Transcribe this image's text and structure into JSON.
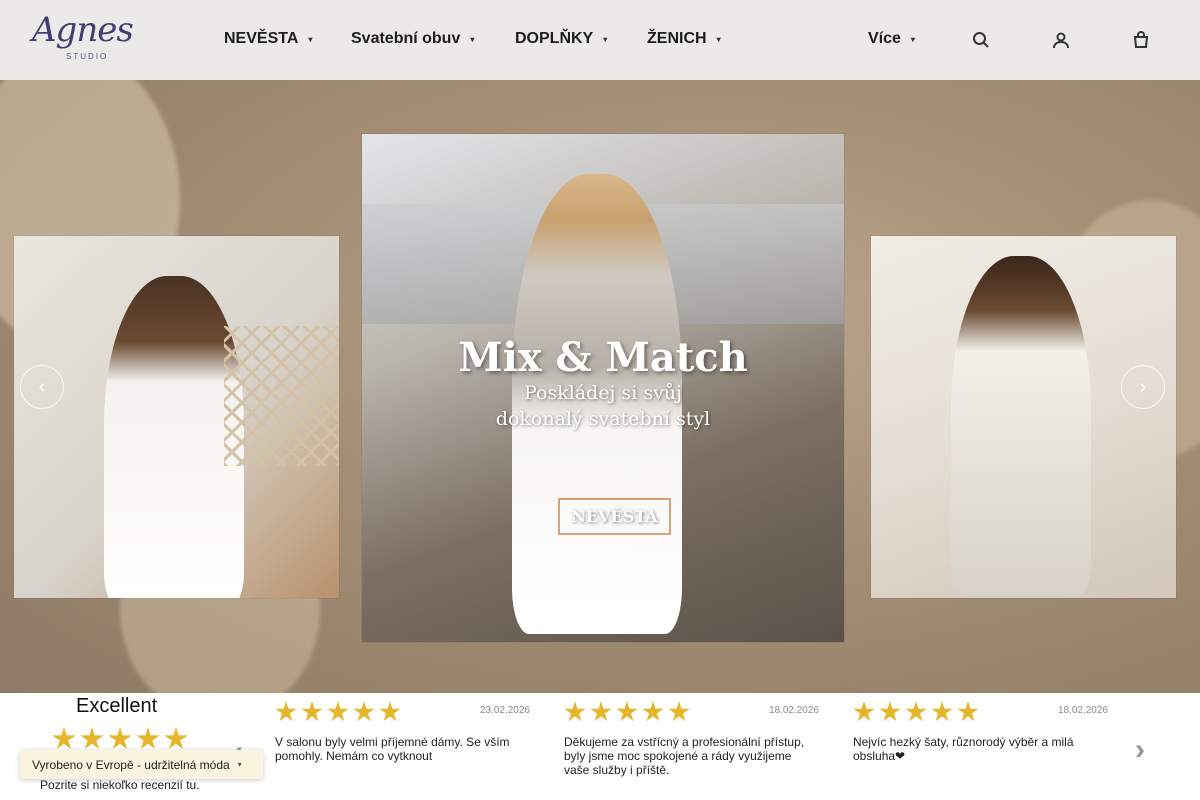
{
  "logo": {
    "script": "Agnes",
    "sub": "STUDIO"
  },
  "nav": {
    "items": [
      {
        "label": "NEVĚSTA"
      },
      {
        "label": "Svatební obuv"
      },
      {
        "label": "DOPLŇKY"
      },
      {
        "label": "ŽENICH"
      },
      {
        "label": "Více"
      }
    ],
    "icons": [
      "search-icon",
      "user-icon",
      "cart-icon"
    ]
  },
  "hero": {
    "title": "Mix & Match",
    "subtitle_line1": "Poskládej si svůj",
    "subtitle_line2": "dokonalý svatební styl",
    "button": "NEVĚSTA"
  },
  "reviews": {
    "summary": "Excellent",
    "rating_stars": 5,
    "link_text": "Pozrite si niekoľko recenzií tu.",
    "items": [
      {
        "date": "23.02.2026",
        "text": "V salonu byly velmi příjemné dámy. Se vším pomohly. Nemám co vytknout",
        "stars": 5
      },
      {
        "date": "18.02.2026",
        "text": "Děkujeme za vstřícný a profesionální přístup, byly jsme moc spokojené a rády využijeme vaše služby i příště.",
        "stars": 5
      },
      {
        "date": "18.02.2026",
        "text": "Nejvíc hezký šaty, různorodý výběr a milá obsluha❤",
        "stars": 5
      }
    ]
  },
  "badge": {
    "text": "Vyrobeno v Evropě - udržitelná móda"
  },
  "colors": {
    "star": "#e3b62b",
    "accent_button_border": "#d9a07a",
    "header_bg": "#eceae9"
  }
}
